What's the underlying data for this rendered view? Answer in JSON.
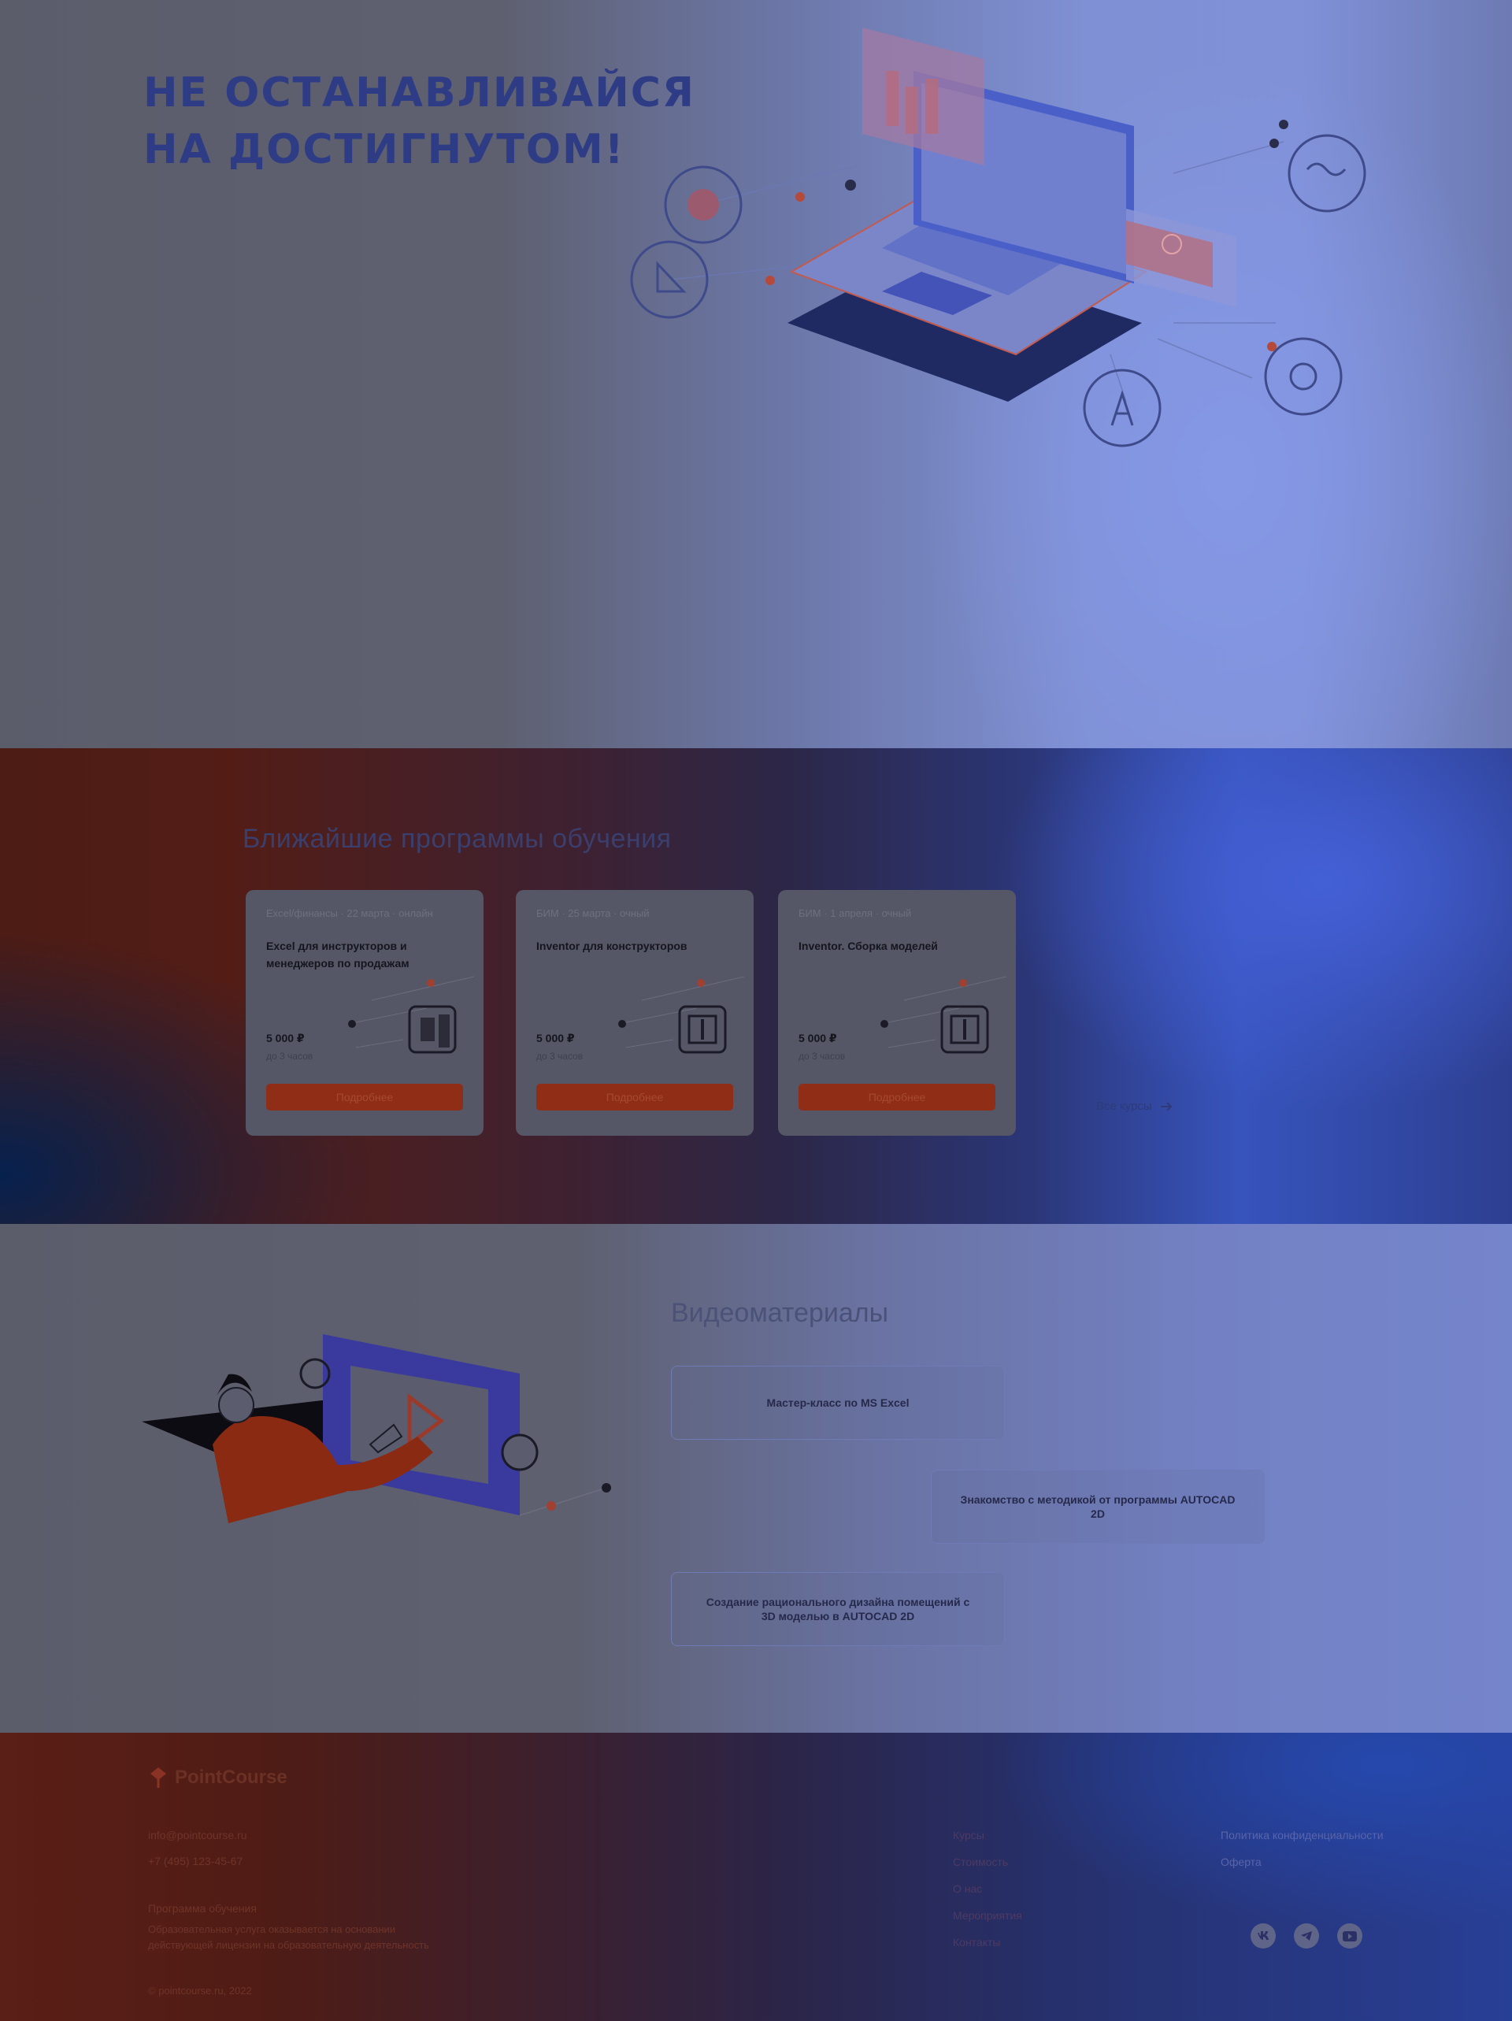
{
  "hero": {
    "title_line1": "НЕ ОСТАНАВЛИВАЙСЯ",
    "title_line2": "НА ДОСТИГНУТОМ!"
  },
  "programs": {
    "heading": "Ближайшие программы обучения",
    "cards": [
      {
        "meta": "Excel/финансы · 22 марта · онлайн",
        "title": "Excel для инструкторов и менеджеров по продажам",
        "price": "5 000 ₽",
        "price_note": "до 3 часов",
        "button": "Подробнее"
      },
      {
        "meta": "БИМ · 25 марта · очный",
        "title": "Inventor для конструкторов",
        "price": "5 000 ₽",
        "price_note": "до 3 часов",
        "button": "Подробнее"
      },
      {
        "meta": "БИМ · 1 апреля · очный",
        "title": "Inventor. Сборка моделей",
        "price": "5 000 ₽",
        "price_note": "до 3 часов",
        "button": "Подробнее"
      }
    ],
    "all_courses": "Все курсы"
  },
  "videos": {
    "heading": "Видеоматериалы",
    "items": [
      "Мастер-класс по MS Excel",
      "Знакомство с методикой от программы AUTOCAD 2D",
      "Создание рационального дизайна помещений с 3D моделью в AUTOCAD 2D"
    ]
  },
  "footer": {
    "logo": "PointCourse",
    "email": "info@pointcourse.ru",
    "phone": "+7 (495) 123-45-67",
    "address_title": "Программа обучения",
    "address_lines": [
      "Образовательная услуга оказывается на основании",
      "действующей лицензии на образовательную деятельность"
    ],
    "copyright": "© pointcourse.ru, 2022",
    "nav": [
      "Курсы",
      "Стоимость",
      "О нас",
      "Мероприятия",
      "Контакты"
    ],
    "legal": [
      "Политика конфиденциальности",
      "Оферта"
    ],
    "socials": [
      "vk-icon",
      "telegram-icon",
      "youtube-icon"
    ]
  }
}
